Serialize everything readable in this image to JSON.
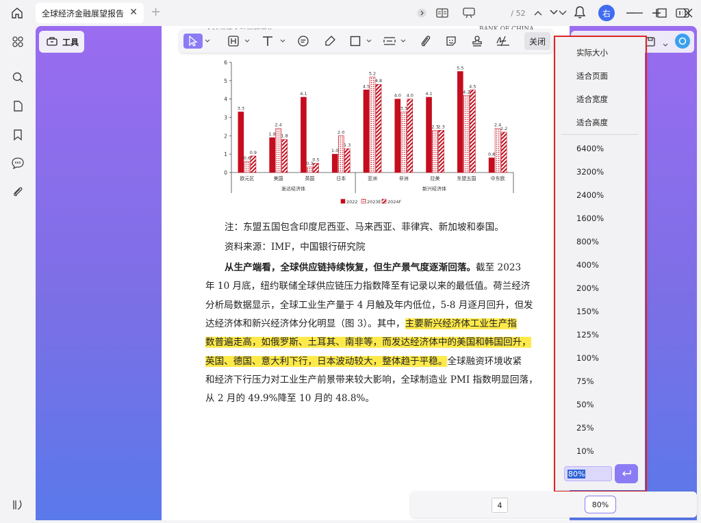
{
  "titlebar": {
    "tab_title": "全球经济金融展望报告",
    "avatar_text": "右"
  },
  "left_panel": {
    "tools_label": "工具"
  },
  "toolbar": {
    "close_label": "关闭"
  },
  "document": {
    "header_left": "全球经济金融展望报告",
    "header_right": "BANK OF CHINA",
    "note1": "注：东盟五国包含印度尼西亚、马来西亚、菲律宾、新加坡和泰国。",
    "note2": "资料来源：IMF，中国银行研究院",
    "para_bold": "从生产端看，全球供应链持续恢复，但生产景气度逐渐回落。",
    "para_l1_tail": "截至 2023",
    "para_l2": "年 10 月底，纽约联储全球供应链压力指数降至有记录以来的最低值。荷兰经济",
    "para_l3": "分析局数据显示，全球工业生产量于 4 月触及年内低位，5-8 月逐月回升，但发",
    "para_l4_pre": "达经济体和新兴经济体分化明显（图 3）。其中，",
    "para_l4_hl": "主要新兴经济体工业生产指",
    "para_l5_hl": "数普遍走高，如俄罗斯、土耳其、南非等，而发达经济体中的美国和韩国回升，",
    "para_l6_hl": "英国、德国、意大利下行，日本波动较大，整体趋于平稳。",
    "para_l6_tail": "全球融资环境收紧",
    "para_l7": "和经济下行压力对工业生产前景带来较大影响，全球制造业 PMI 指数明显回落，",
    "para_l8": "从 2 月的 49.9%降至 10 月的 48.8%。"
  },
  "chart_data": {
    "type": "bar",
    "categories": [
      "欧元区",
      "美国",
      "英国",
      "日本",
      "亚洲",
      "非洲",
      "拉美",
      "东盟五国",
      "中东欧"
    ],
    "groups": [
      {
        "label": "发达经济体",
        "categories": [
          "欧元区",
          "美国",
          "英国",
          "日本"
        ]
      },
      {
        "label": "新兴经济体",
        "categories": [
          "亚洲",
          "非洲",
          "拉美",
          "东盟五国",
          "中东欧"
        ]
      }
    ],
    "series": [
      {
        "name": "2022",
        "values": [
          3.3,
          1.9,
          4.1,
          1.0,
          4.5,
          4.0,
          4.1,
          5.5,
          0.8
        ],
        "color": "#c40d1e",
        "pattern": "solid"
      },
      {
        "name": "2023E",
        "values": [
          0.6,
          2.4,
          0.3,
          2.0,
          5.2,
          3.3,
          2.3,
          4.2,
          2.4
        ],
        "color": "#c40d1e",
        "pattern": "dots"
      },
      {
        "name": "2024F",
        "values": [
          0.9,
          1.8,
          0.5,
          1.3,
          4.8,
          4.0,
          2.3,
          4.5,
          2.2
        ],
        "color": "#c40d1e",
        "pattern": "hatch"
      }
    ],
    "data_labels": [
      [
        "3.3",
        "0.6",
        "0.9"
      ],
      [
        "1.9",
        "2.4",
        "1.8"
      ],
      [
        "4.1",
        "0.3",
        "0.5"
      ],
      [
        "1.0",
        "2.0",
        "1.3"
      ],
      [
        "4.5",
        "5.2",
        "4.8"
      ],
      [
        "4.0",
        "3.3",
        "4.0"
      ],
      [
        "4.1",
        "2.3",
        "2.3"
      ],
      [
        "5.5",
        "4.2",
        "4.5"
      ],
      [
        "0.8",
        "2.4",
        "2.2"
      ]
    ],
    "ylim": [
      0,
      6
    ],
    "yticks": [
      "0",
      "1",
      "2",
      "3",
      "4",
      "5",
      "6"
    ],
    "legend_position": "bottom",
    "title": "",
    "xlabel": "",
    "ylabel": ""
  },
  "zoom_menu": {
    "fit_items": [
      "实际大小",
      "适合页面",
      "适合宽度",
      "适合高度"
    ],
    "percent_items": [
      "6400%",
      "3200%",
      "2400%",
      "1600%",
      "800%",
      "400%",
      "200%",
      "150%",
      "125%",
      "100%",
      "75%",
      "50%",
      "25%",
      "10%"
    ],
    "input_value": "80%"
  },
  "bottom_bar": {
    "current_page": "4",
    "total_pages": "/ 52",
    "zoom_value": "80%"
  }
}
